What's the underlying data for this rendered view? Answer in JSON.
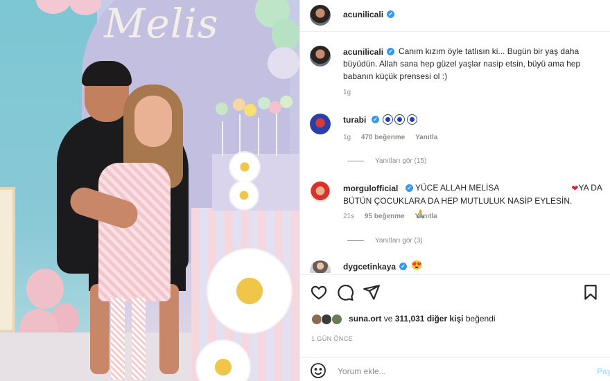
{
  "photo": {
    "script_text": "Melis",
    "alt": ""
  },
  "header": {
    "username": "acunilicali",
    "verified": true
  },
  "comments": [
    {
      "username": "acunilicali",
      "verified": true,
      "text": "Canım kızım öyle tatlısın ki... Bugün bir yaş daha büyüdün. Allah sana hep güzel yaşlar nasip etsin, büyü ama hep babanın küçük prensesi ol :)",
      "time": "1g"
    },
    {
      "username": "turabi",
      "verified": true,
      "text": "",
      "time": "1g",
      "likes": "470 beğenme",
      "reply": "Yanıtla",
      "view_replies": "Yanıtları gör (15)"
    },
    {
      "username": "morgulofficial",
      "verified": true,
      "text_before_emoji": "YÜCE ALLAH MELİSA",
      "text_after_emoji": "YA DA BÜTÜN ÇOCUKLARA DA HEP MUTLULUK NASİP EYLESİN.",
      "time": "21s",
      "likes": "95 beğenme",
      "reply": "Yanıtla",
      "view_replies": "Yanıtları gör (3)"
    },
    {
      "username": "dygcetinkaya",
      "verified": true
    }
  ],
  "likes": {
    "liker": "suna.ort",
    "connector": "ve",
    "count_text": "311,031 diğer kişi",
    "suffix": "beğendi"
  },
  "date": "1 GÜN ÖNCE",
  "compose": {
    "placeholder": "Yorum ekle...",
    "post_label": "Pay"
  },
  "icons": {
    "like": "heart-icon",
    "comment": "comment-icon",
    "share": "send-icon",
    "save": "bookmark-icon",
    "emoji": "smiley-icon"
  },
  "colors": {
    "verified": "#3897f0",
    "muted": "#8e8e8e",
    "post_button": "#b2dffc"
  }
}
